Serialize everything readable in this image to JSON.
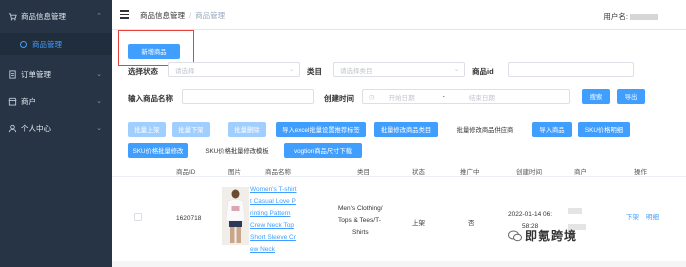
{
  "sidebar": {
    "items": [
      {
        "label": "商品信息管理",
        "icon": "shopping-cart-icon"
      },
      {
        "label": "商品管理",
        "icon": "circle-icon"
      },
      {
        "label": "订单管理",
        "icon": "document-icon"
      },
      {
        "label": "商户",
        "icon": "store-icon"
      },
      {
        "label": "个人中心",
        "icon": "user-icon"
      }
    ]
  },
  "header": {
    "breadcrumb": [
      "商品信息管理",
      "商品管理"
    ],
    "user_label": "用户名:"
  },
  "toolbar": {
    "new_product": "新增商品"
  },
  "filters": {
    "status_label": "选择状态",
    "status_placeholder": "请选择",
    "category_label": "类目",
    "category_placeholder": "请选择类目",
    "product_id_label": "商品id",
    "product_name_label": "输入商品名称",
    "created_time_label": "创建时间",
    "start_placeholder": "开始日期",
    "range_sep": "-",
    "end_placeholder": "结束日期",
    "search_button": "搜索",
    "export_button": "导出"
  },
  "actions": {
    "row1": [
      "批量上架",
      "批量下架",
      "批量删除",
      "导入excel批量设置推荐标签",
      "批量修改商品类目",
      "批量修改商品供应商",
      "导入商品",
      "SKU价格明细"
    ],
    "row2": [
      "SKU价格批量修改",
      "SKU价格批量修改模板",
      "vogtion商品尺寸下载"
    ]
  },
  "table": {
    "columns": [
      "商品ID",
      "图片",
      "商品名称",
      "类目",
      "状态",
      "推广中",
      "创建时间",
      "商户",
      "操作"
    ],
    "rows": [
      {
        "id": "1620718",
        "name_lines": [
          "Women's T-shirt",
          "t Casual Love P",
          "rinting Pattern",
          "Crew Neck Top",
          "Short Sleeve Cr",
          "ew Neck"
        ],
        "category_lines": [
          "Men's Clothing/",
          "Tops & Tees/T-",
          "Shirts"
        ],
        "status": "上架",
        "promoting": "否",
        "created_lines": [
          "2022-01-14 06:",
          "58:28"
        ],
        "ops": [
          "下架",
          "明细"
        ]
      }
    ]
  },
  "watermark": {
    "text": "即氪跨境"
  }
}
